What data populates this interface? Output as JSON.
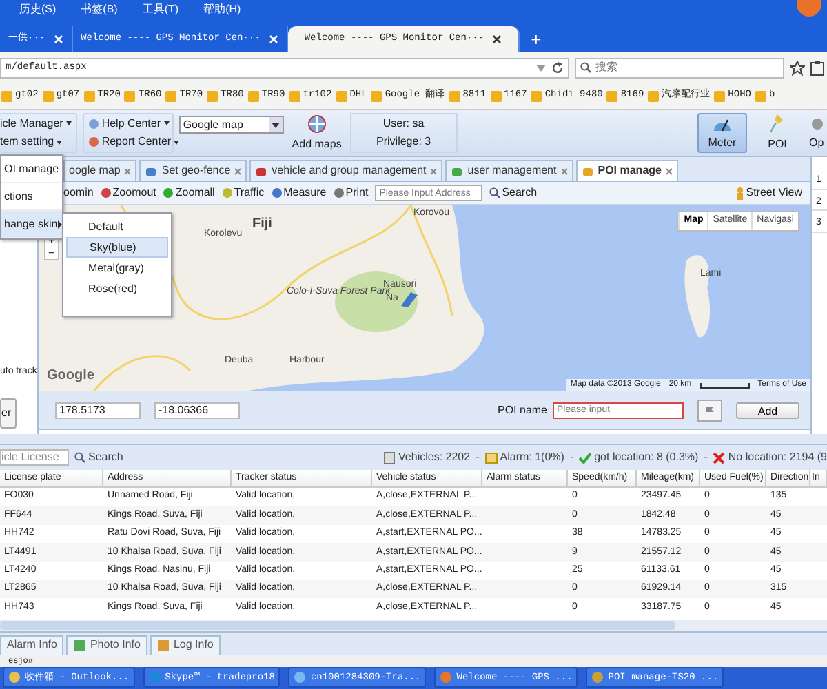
{
  "browser": {
    "menu": [
      "历史(S)",
      "书签(B)",
      "工具(T)",
      "帮助(H)"
    ],
    "tabs": [
      {
        "label": "一供···",
        "selected": false
      },
      {
        "label": "Welcome ---- GPS Monitor Cen···",
        "selected": false
      },
      {
        "label": "Welcome ---- GPS Monitor Cen···",
        "selected": true
      }
    ],
    "new_tab": "+",
    "address": "m/default.aspx",
    "search": {
      "placeholder": "搜索"
    },
    "bookmarks": [
      "gt02",
      "gt07",
      "TR20",
      "TR60",
      "TR70",
      "TR80",
      "TR90",
      "tr102",
      "DHL",
      "Google 翻译",
      "8811",
      "1167",
      "Chidi 9480",
      "8169",
      "汽摩配行业",
      "HOHO",
      "b"
    ]
  },
  "app_toolbar": {
    "menus": [
      "icle Manager",
      "tem setting",
      "Help Center",
      "Report Center"
    ],
    "map_select": "Google map",
    "add_maps": "Add maps",
    "user": "User: sa",
    "privilege": "Privilege: 3",
    "tools": [
      {
        "label": "Meter",
        "selected": true
      },
      {
        "label": "POI",
        "selected": false
      },
      {
        "label": "Op",
        "selected": false
      }
    ]
  },
  "system_menu": {
    "items": [
      {
        "label": "OI manage",
        "has_submenu": false,
        "selected": false
      },
      {
        "label": "ctions",
        "has_submenu": false,
        "selected": false
      },
      {
        "label": "hange skin",
        "has_submenu": true,
        "selected": true
      }
    ]
  },
  "skin_menu": {
    "items": [
      {
        "label": "Default",
        "selected": false
      },
      {
        "label": "Sky(blue)",
        "selected": true
      },
      {
        "label": "Metal(gray)",
        "selected": false
      },
      {
        "label": "Rose(red)",
        "selected": false
      }
    ]
  },
  "tabs": [
    {
      "label": "oogle map",
      "selected": false
    },
    {
      "label": "Set geo-fence",
      "selected": false
    },
    {
      "label": "vehicle and group management",
      "selected": false
    },
    {
      "label": "user management",
      "selected": false
    },
    {
      "label": "POI manage",
      "selected": true
    }
  ],
  "map_toolbar": {
    "buttons": [
      "oomin",
      "Zoomout",
      "Zoomall",
      "Traffic",
      "Measure",
      "Print"
    ],
    "address": {
      "placeholder": "Please Input Address"
    },
    "search": "Search",
    "street_view": "Street View"
  },
  "map": {
    "types": [
      {
        "label": "Map",
        "selected": true
      },
      {
        "label": "Satellite",
        "selected": false
      },
      {
        "label": "Navigasi",
        "selected": false
      }
    ],
    "zoom_controls": [
      "+",
      "−"
    ],
    "labels": [
      "Fiji",
      "Korolevu",
      "Korovou",
      "Colo-I-Suva Forest Park",
      "Nausori",
      "Na",
      "Lami",
      "Deuba",
      "Harbour"
    ],
    "logo": "Google",
    "attribution": "Map data ©2013 Google",
    "scale": "20 km",
    "terms": "Terms of Use"
  },
  "left_panel": {
    "auto_track": "uto track",
    "button": "er"
  },
  "right_panel": {
    "rows": [
      "1",
      "2",
      "3"
    ]
  },
  "poi_form": {
    "longitude": "178.5173",
    "latitude": "-18.06366",
    "name_label": "POI name",
    "name": {
      "placeholder": "Please input"
    },
    "add": "Add"
  },
  "vehicle_bar": {
    "license": "icle License",
    "search": "Search",
    "stats": [
      "Vehicles: 2202",
      "Alarm: 1(0%)",
      "got location: 8 (0.3%)",
      "No location: 2194 (9"
    ],
    "separator": "-"
  },
  "table": {
    "columns": [
      "License plate",
      "Address",
      "Tracker status",
      "Vehicle status",
      "Alarm status",
      "Speed(km/h)",
      "Mileage(km)",
      "Used Fuel(%)",
      "Direction",
      "In"
    ],
    "rows": [
      [
        "FO030",
        "Unnamed Road, Fiji",
        "Valid location,",
        "A,close,EXTERNAL P...",
        "",
        "0",
        "23497.45",
        "0",
        "135"
      ],
      [
        "FF644",
        "Kings Road, Suva, Fiji",
        "Valid location,",
        "A,close,EXTERNAL P...",
        "",
        "0",
        "1842.48",
        "0",
        "45"
      ],
      [
        "HH742",
        "Ratu Dovi Road, Suva, Fiji",
        "Valid location,",
        "A,start,EXTERNAL PO...",
        "",
        "38",
        "14783.25",
        "0",
        "45"
      ],
      [
        "LT4491",
        "10 Khalsa Road, Suva, Fiji",
        "Valid location,",
        "A,start,EXTERNAL PO...",
        "",
        "9",
        "21557.12",
        "0",
        "45"
      ],
      [
        "LT4240",
        "Kings Road, Nasinu, Fiji",
        "Valid location,",
        "A,start,EXTERNAL PO...",
        "",
        "25",
        "61133.61",
        "0",
        "45"
      ],
      [
        "LT2865",
        "10 Khalsa Road, Suva, Fiji",
        "Valid location,",
        "A,close,EXTERNAL P...",
        "",
        "0",
        "61929.14",
        "0",
        "315"
      ],
      [
        "HH743",
        "Kings Road, Suva, Fiji",
        "Valid location,",
        "A,close,EXTERNAL P...",
        "",
        "0",
        "33187.75",
        "0",
        "45"
      ]
    ]
  },
  "bottom_tabs": [
    "Alarm Info",
    "Photo Info",
    "Log Info"
  ],
  "status_text": "esjo#",
  "taskbar": [
    "收件箱 - Outlook...",
    "Skype™ - tradepro18",
    "cn1001284309-Tra...",
    "Welcome ---- GPS ...",
    "POI manage-TS20 ..."
  ]
}
